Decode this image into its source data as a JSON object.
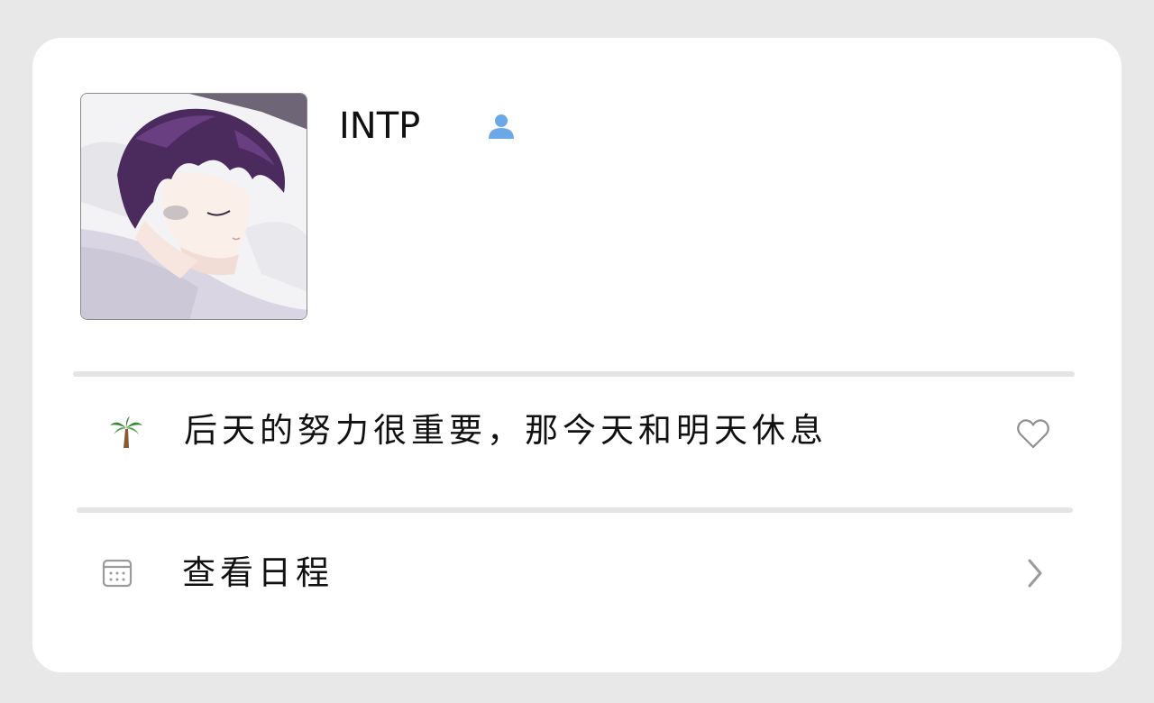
{
  "profile": {
    "name": "INTP",
    "avatar_icon": "anime-avatar-image",
    "person_icon": "person-icon",
    "person_icon_color": "#6aa8e8"
  },
  "status": {
    "icon": "palm-tree-icon",
    "text": "后天的努力很重要，那今天和明天休息",
    "action_icon": "heart-outline-icon"
  },
  "schedule": {
    "icon": "calendar-icon",
    "label": "查看日程",
    "action_icon": "chevron-right-icon"
  },
  "colors": {
    "background": "#e8e8e8",
    "card": "#ffffff",
    "divider": "#e4e4e4",
    "text": "#111111",
    "icon_gray": "#9a9a9a"
  }
}
